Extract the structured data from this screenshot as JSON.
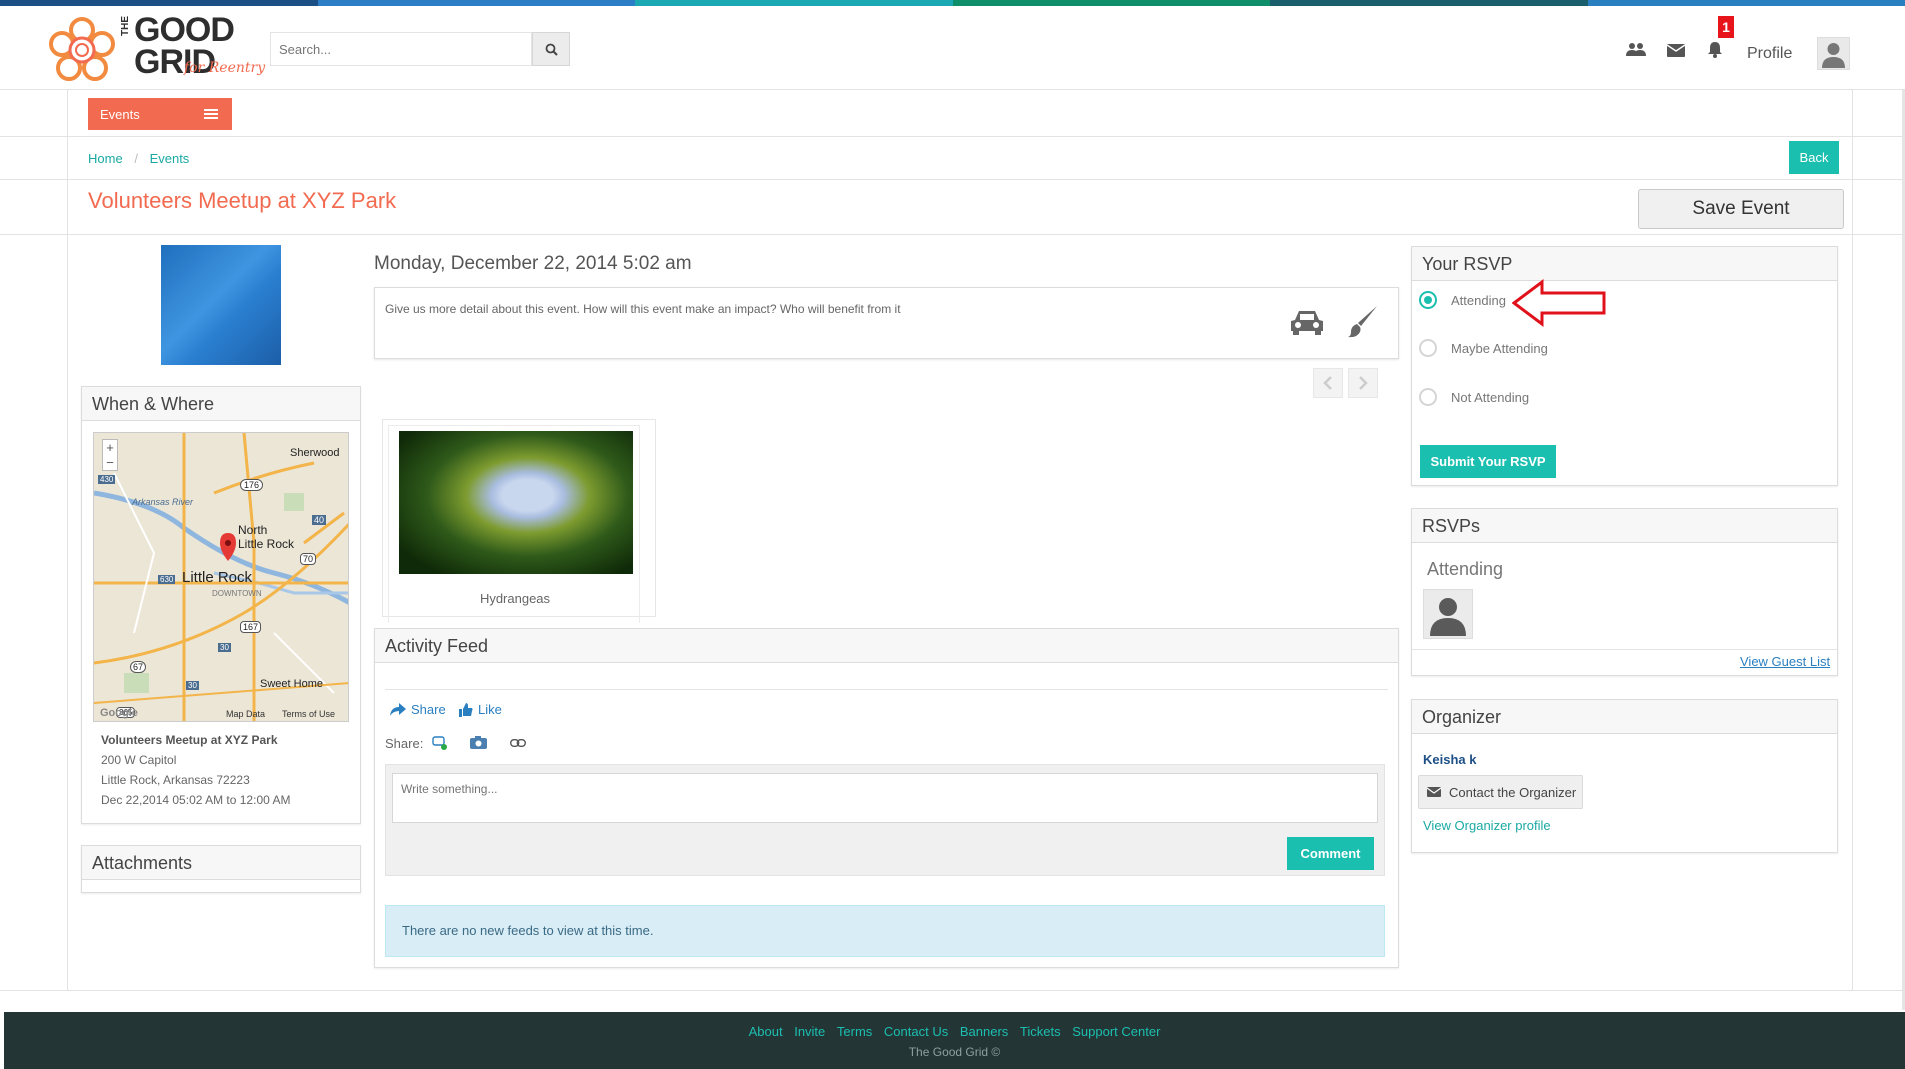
{
  "brand": {
    "name_top": "GOOD",
    "name_bottom": "GRID",
    "the": "THE",
    "sub": "for Reentry",
    "strip_colors": [
      "#1c4f86",
      "#2c7fc6",
      "#1aa9b3",
      "#0e8f6a",
      "#1b5e6b",
      "#2a7fc1"
    ]
  },
  "header": {
    "search_placeholder": "Search...",
    "notifications_count": "1",
    "profile_label": "Profile",
    "icons": [
      "users-icon",
      "envelope-icon",
      "bell-icon",
      "search-icon",
      "user-avatar-icon"
    ]
  },
  "nav": {
    "events_label": "Events"
  },
  "breadcrumb": {
    "home": "Home",
    "events": "Events",
    "separator": "/"
  },
  "actions": {
    "back": "Back",
    "save_event": "Save Event"
  },
  "event": {
    "title": "Volunteers Meetup at XYZ Park",
    "date": "Monday, December 22, 2014 5:02 am",
    "description": "Give us more detail about this event. How will this event make an impact? Who will benefit from it"
  },
  "when_where": {
    "heading": "When & Where",
    "map": {
      "zoom_in": "+",
      "zoom_out": "−",
      "places": [
        "Sherwood",
        "North",
        "Little Rock",
        "Little Rock",
        "DOWNTOWN",
        "Sweet Home",
        "Arkansas River"
      ],
      "shields": [
        "430",
        "176",
        "40",
        "70",
        "630",
        "167",
        "30",
        "67",
        "30",
        "365"
      ],
      "footer_left": "Google",
      "footer_data": "Map Data",
      "footer_terms": "Terms of Use"
    },
    "address_name": "Volunteers Meetup at XYZ Park",
    "address_line1": "200 W Capitol",
    "address_line2": "Little Rock, Arkansas 72223",
    "datetime_range": "Dec 22,2014 05:02 AM to 12:00 AM"
  },
  "attachments": {
    "heading": "Attachments"
  },
  "gallery": {
    "caption": "Hydrangeas"
  },
  "activity_feed": {
    "heading": "Activity Feed",
    "share": "Share",
    "like": "Like",
    "share_label": "Share:",
    "placeholder": "Write something...",
    "comment_button": "Comment",
    "empty_message": "There are no new feeds to view at this time."
  },
  "rsvp": {
    "heading": "Your RSVP",
    "options": [
      "Attending",
      "Maybe Attending",
      "Not Attending"
    ],
    "selected": "Attending",
    "submit": "Submit Your RSVP"
  },
  "rsvps": {
    "heading": "RSVPs",
    "attending_heading": "Attending",
    "view_guest_list": "View Guest List"
  },
  "organizer": {
    "heading": "Organizer",
    "name": "Keisha k",
    "contact": "Contact the Organizer",
    "view_profile": "View Organizer profile"
  },
  "footer": {
    "links": [
      "About",
      "Invite",
      "Terms",
      "Contact Us",
      "Banners",
      "Tickets",
      "Support Center"
    ],
    "copyright": "The Good Grid ©"
  },
  "colors": {
    "accent_orange": "#f26a4f",
    "accent_teal": "#1bbfb0",
    "link_blue": "#2a7fc1",
    "footer_bg": "#243536"
  }
}
